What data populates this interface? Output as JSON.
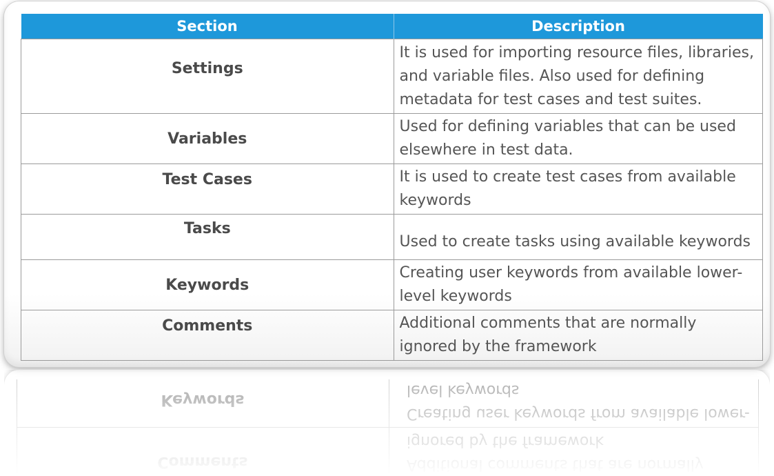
{
  "table": {
    "headers": {
      "section": "Section",
      "description": "Description"
    },
    "rows": [
      {
        "section": "Settings",
        "description": "It is used for importing resource files, libraries, and variable files. Also used for defining metadata for test cases and test suites."
      },
      {
        "section": "Variables",
        "description": "Used for defining variables that can be used elsewhere in test data."
      },
      {
        "section": "Test Cases",
        "description": "It is used to create test cases from available keywords"
      },
      {
        "section": "Tasks",
        "description": "Used to create tasks using available keywords"
      },
      {
        "section": "Keywords",
        "description": "Creating user keywords from available lower-level keywords"
      },
      {
        "section": "Comments",
        "description": "Additional comments that are normally ignored by the framework"
      }
    ]
  },
  "colors": {
    "header_bg": "#1e98da",
    "header_text": "#ffffff",
    "section_text": "#4a4a4a",
    "description_text": "#555555",
    "border": "#9a9a9a"
  }
}
